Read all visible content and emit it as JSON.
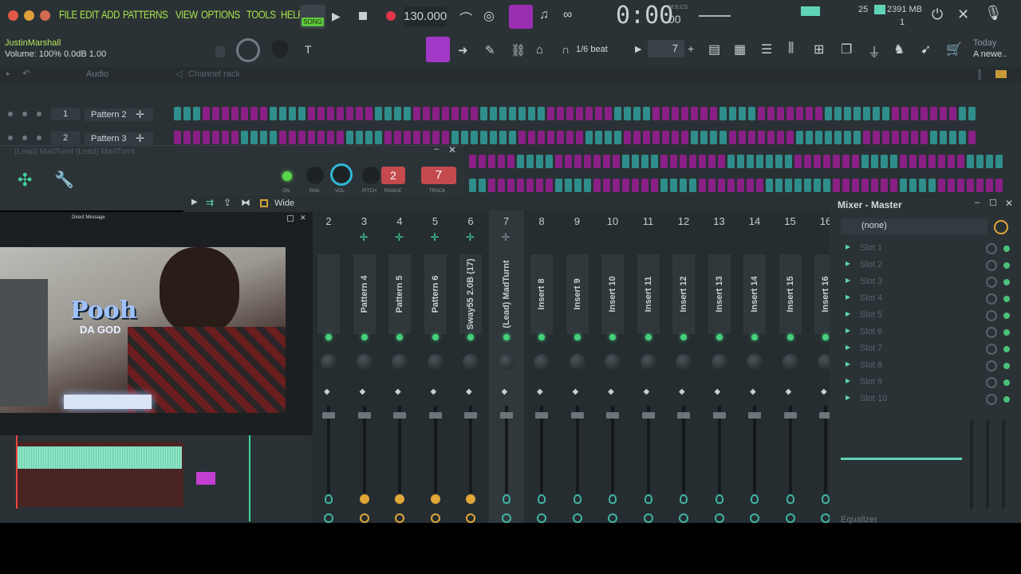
{
  "menu": [
    "FILE",
    "EDIT",
    "ADD",
    "PATTERNS",
    "VIEW",
    "OPTIONS",
    "TOOLS",
    "HELP"
  ],
  "transport": {
    "mode_label": "SONG",
    "tempo": "130.000",
    "time": "0:00",
    "time_unit": "00",
    "time_sub": "M:S:CS"
  },
  "status": {
    "cpu": "25",
    "ram": "2391 MB",
    "voices": "1"
  },
  "hint": {
    "user": "JustinMarshall",
    "volume": "Volume: 100% 0.0dB 1.00"
  },
  "snap": "1/6 beat",
  "pattern_num": "7",
  "news": {
    "title": "Today",
    "text": "A newe.."
  },
  "rack": {
    "filter": "Audio",
    "title": "Channel rack",
    "channels": [
      {
        "num": "1",
        "name": "Pattern 2"
      },
      {
        "num": "2",
        "name": "Pattern 3"
      }
    ]
  },
  "plugin": {
    "title": "(Lead) MadTurnt (Lead) MadTurnt",
    "pitch": "2",
    "track": "7",
    "labels": [
      "ON",
      "PAN",
      "VOL",
      "PITCH",
      "RANGE",
      "TRACK"
    ]
  },
  "mixer": {
    "view": "Wide",
    "strips": [
      {
        "num": "2",
        "name": ""
      },
      {
        "num": "3",
        "name": "Pattern 4"
      },
      {
        "num": "4",
        "name": "Pattern 5"
      },
      {
        "num": "5",
        "name": "Pattern 6"
      },
      {
        "num": "6",
        "name": "Sway55 2.0B (17)"
      },
      {
        "num": "7",
        "name": "(Lead) MadTurnt"
      },
      {
        "num": "8",
        "name": "Insert 8"
      },
      {
        "num": "9",
        "name": "Insert 9"
      },
      {
        "num": "10",
        "name": "Insert 10"
      },
      {
        "num": "11",
        "name": "Insert 11"
      },
      {
        "num": "12",
        "name": "Insert 12"
      },
      {
        "num": "13",
        "name": "Insert 13"
      },
      {
        "num": "14",
        "name": "Insert 14"
      },
      {
        "num": "15",
        "name": "Insert 15"
      },
      {
        "num": "16",
        "name": "Insert 16"
      }
    ]
  },
  "master": {
    "title": "Mixer - Master",
    "preset": "(none)",
    "slots": [
      "Slot 1",
      "Slot 2",
      "Slot 3",
      "Slot 4",
      "Slot 5",
      "Slot 6",
      "Slot 7",
      "Slot 8",
      "Slot 9",
      "Slot 10"
    ],
    "eq": "Equalizer"
  },
  "webcam": {
    "title": "Direct Message",
    "logo": "Pooh",
    "logo_sub": "DA GOD"
  }
}
